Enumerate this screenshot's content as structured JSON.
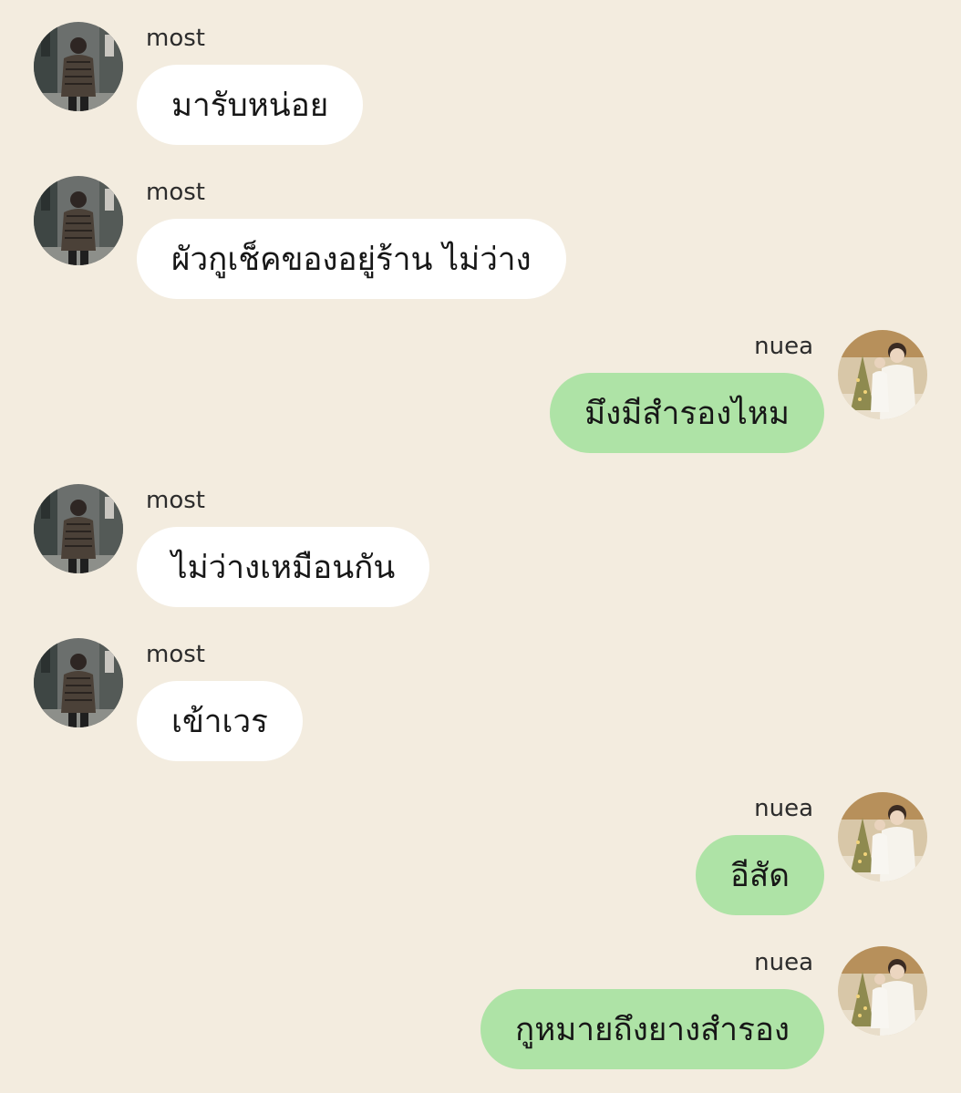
{
  "chat": {
    "messages": [
      {
        "direction": "incoming",
        "sender": "most",
        "text": "มารับหน่อย",
        "avatar": "most-avatar-photo"
      },
      {
        "direction": "incoming",
        "sender": "most",
        "text": "ผัวกูเช็คของอยู่ร้าน ไม่ว่าง",
        "avatar": "most-avatar-photo"
      },
      {
        "direction": "outgoing",
        "sender": "nuea",
        "text": "มึงมีสำรองไหม",
        "avatar": "nuea-avatar-photo"
      },
      {
        "direction": "incoming",
        "sender": "most",
        "text": "ไม่ว่างเหมือนกัน",
        "avatar": "most-avatar-photo"
      },
      {
        "direction": "incoming",
        "sender": "most",
        "text": "เข้าเวร",
        "avatar": "most-avatar-photo"
      },
      {
        "direction": "outgoing",
        "sender": "nuea",
        "text": "อีสัด",
        "avatar": "nuea-avatar-photo"
      },
      {
        "direction": "outgoing",
        "sender": "nuea",
        "text": "กูหมายถึงยางสำรอง",
        "avatar": "nuea-avatar-photo"
      }
    ]
  },
  "colors": {
    "background": "#f3ecdf",
    "incoming_bubble": "#ffffff",
    "outgoing_bubble": "#aee3a6",
    "text": "#171717"
  }
}
